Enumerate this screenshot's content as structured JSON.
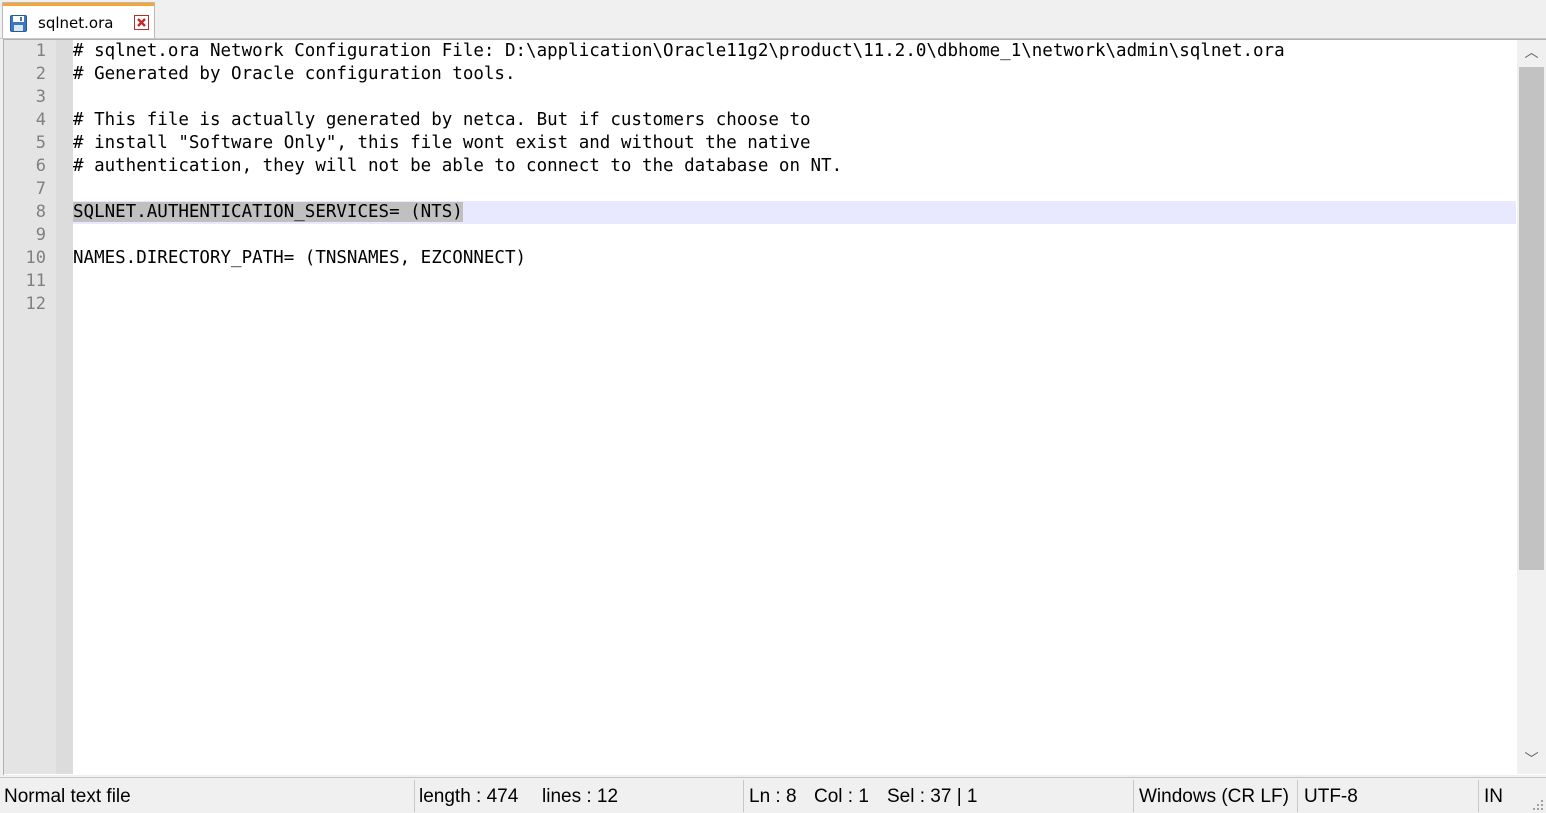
{
  "tab": {
    "label": "sqlnet.ora",
    "icon": "save-icon",
    "close_icon": "close-icon"
  },
  "editor": {
    "lines": [
      {
        "num": "1",
        "text": "# sqlnet.ora Network Configuration File: D:\\application\\Oracle11g2\\product\\11.2.0\\dbhome_1\\network\\admin\\sqlnet.ora"
      },
      {
        "num": "2",
        "text": "# Generated by Oracle configuration tools."
      },
      {
        "num": "3",
        "text": ""
      },
      {
        "num": "4",
        "text": "# This file is actually generated by netca. But if customers choose to"
      },
      {
        "num": "5",
        "text": "# install \"Software Only\", this file wont exist and without the native"
      },
      {
        "num": "6",
        "text": "# authentication, they will not be able to connect to the database on NT."
      },
      {
        "num": "7",
        "text": ""
      },
      {
        "num": "8",
        "text": "SQLNET.AUTHENTICATION_SERVICES= (NTS)"
      },
      {
        "num": "9",
        "text": ""
      },
      {
        "num": "10",
        "text": "NAMES.DIRECTORY_PATH= (TNSNAMES, EZCONNECT)"
      },
      {
        "num": "11",
        "text": ""
      },
      {
        "num": "12",
        "text": ""
      }
    ],
    "current_line": 8,
    "selected_text": "SQLNET.AUTHENTICATION_SERVICES= (NTS)"
  },
  "scrollbar": {
    "up_glyph": "︿",
    "down_glyph": "﹀"
  },
  "statusbar": {
    "file_type": "Normal text file",
    "length": "length : 474",
    "lines": "lines : 12",
    "ln": "Ln : 8",
    "col": "Col : 1",
    "sel": "Sel : 37 | 1",
    "eol": "Windows (CR LF)",
    "encoding": "UTF-8",
    "mode": "IN"
  },
  "colors": {
    "tab_accent": "#f5a436",
    "current_line": "#e8e8ff",
    "selection": "#c0c0c0",
    "gutter": "#e4e4e4"
  }
}
